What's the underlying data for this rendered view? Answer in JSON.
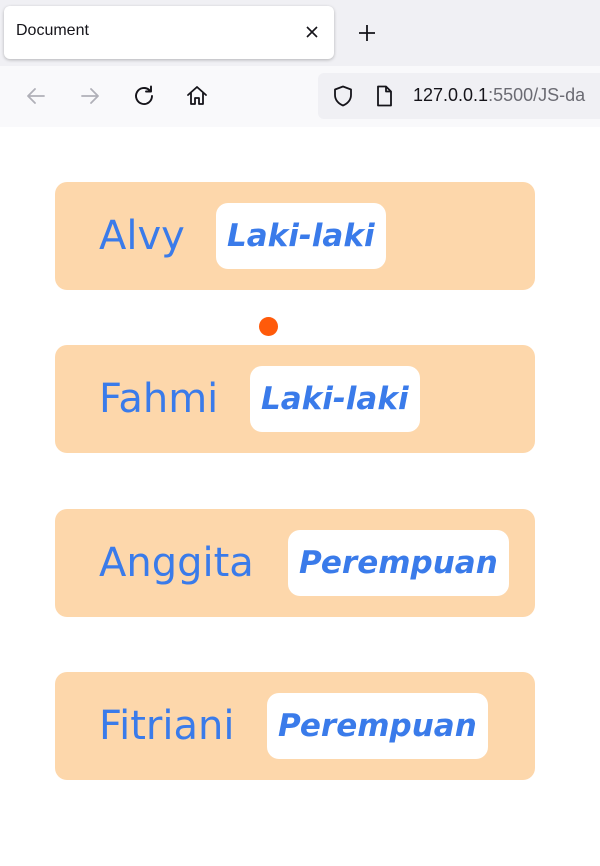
{
  "browser": {
    "tab_title": "Document",
    "url_host": "127.0.0.1",
    "url_rest": ":5500/JS-da"
  },
  "cards": [
    {
      "name": "Alvy",
      "gender": "Laki-laki"
    },
    {
      "name": "Fahmi",
      "gender": "Laki-laki"
    },
    {
      "name": "Anggita",
      "gender": "Perempuan"
    },
    {
      "name": "Fitriani",
      "gender": "Perempuan"
    }
  ],
  "colors": {
    "card_bg": "#fdd7ab",
    "text": "#3a7bea",
    "badge_bg": "#ffffff",
    "dot": "#ff5a0a"
  },
  "icons": {
    "tab_close": "close-icon",
    "new_tab": "plus-icon",
    "back": "arrow-left-icon",
    "forward": "arrow-right-icon",
    "reload": "reload-icon",
    "home": "home-icon",
    "shield": "shield-icon",
    "page": "page-icon"
  }
}
